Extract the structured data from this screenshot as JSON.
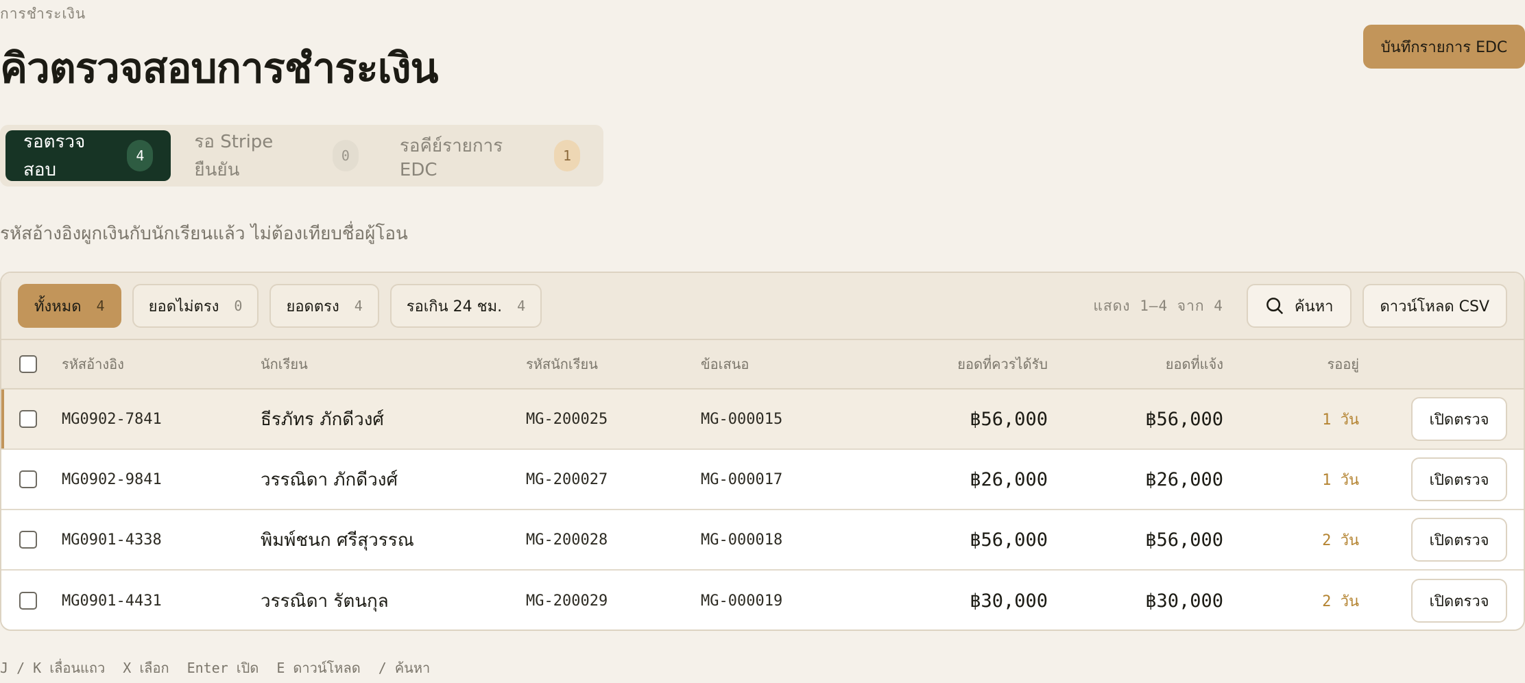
{
  "breadcrumb": "การชำระเงิน",
  "page_title": "คิวตรวจสอบการชำระเงิน",
  "edc_button": "บันทึกรายการ EDC",
  "tabs": [
    {
      "label": "รอตรวจสอบ",
      "count": "4"
    },
    {
      "label": "รอ Stripe ยืนยัน",
      "count": "0"
    },
    {
      "label": "รอคีย์รายการ EDC",
      "count": "1"
    }
  ],
  "subtitle": "รหัสอ้างอิงผูกเงินกับนักเรียนแล้ว ไม่ต้องเทียบชื่อผู้โอน",
  "filters": [
    {
      "label": "ทั้งหมด",
      "count": "4"
    },
    {
      "label": "ยอดไม่ตรง",
      "count": "0"
    },
    {
      "label": "ยอดตรง",
      "count": "4"
    },
    {
      "label": "รอเกิน 24 ชม.",
      "count": "4"
    }
  ],
  "showing": "แสดง 1–4 จาก 4",
  "search_label": "ค้นหา",
  "csv_label": "ดาวน์โหลด CSV",
  "columns": {
    "ref": "รหัสอ้างอิง",
    "student": "นักเรียน",
    "student_id": "รหัสนักเรียน",
    "offer": "ข้อเสนอ",
    "expected": "ยอดที่ควรได้รับ",
    "reported": "ยอดที่แจ้ง",
    "waiting": "รออยู่"
  },
  "rows": [
    {
      "ref": "MG0902-7841",
      "student": "ธีรภัทร ภักดีวงศ์",
      "student_id": "MG-200025",
      "offer": "MG-000015",
      "expected": "฿56,000",
      "reported": "฿56,000",
      "waiting": "1 วัน",
      "action": "เปิดตรวจ"
    },
    {
      "ref": "MG0902-9841",
      "student": "วรรณิดา ภักดีวงศ์",
      "student_id": "MG-200027",
      "offer": "MG-000017",
      "expected": "฿26,000",
      "reported": "฿26,000",
      "waiting": "1 วัน",
      "action": "เปิดตรวจ"
    },
    {
      "ref": "MG0901-4338",
      "student": "พิมพ์ชนก ศรีสุวรรณ",
      "student_id": "MG-200028",
      "offer": "MG-000018",
      "expected": "฿56,000",
      "reported": "฿56,000",
      "waiting": "2 วัน",
      "action": "เปิดตรวจ"
    },
    {
      "ref": "MG0901-4431",
      "student": "วรรณิดา รัตนกุล",
      "student_id": "MG-200029",
      "offer": "MG-000019",
      "expected": "฿30,000",
      "reported": "฿30,000",
      "waiting": "2 วัน",
      "action": "เปิดตรวจ"
    }
  ],
  "shortcuts": [
    "J / K เลื่อนแถว",
    "X เลือก",
    "Enter เปิด",
    "E ดาวน์โหลด",
    "/ ค้นหา"
  ],
  "colors": {
    "accent": "#c2955a",
    "active_tab": "#173425",
    "background": "#f5f1ea",
    "waiting_text": "#b48432"
  }
}
